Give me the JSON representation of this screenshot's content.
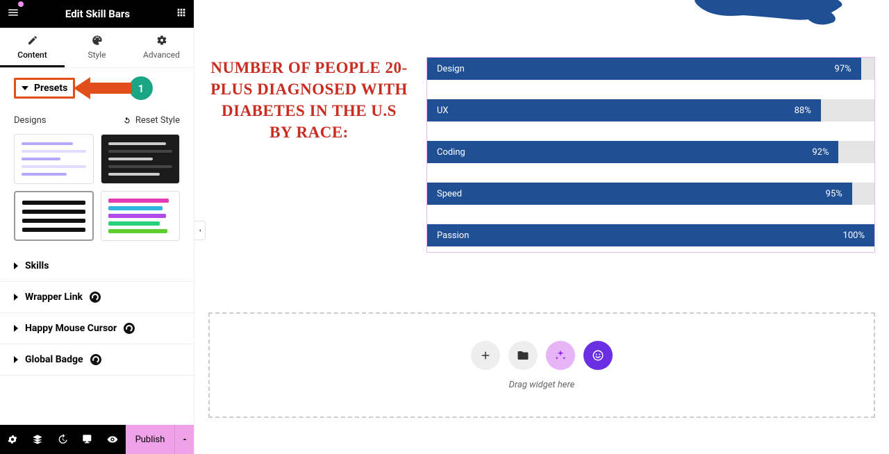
{
  "header": {
    "title": "Edit Skill Bars"
  },
  "tabs": {
    "content": "Content",
    "style": "Style",
    "advanced": "Advanced"
  },
  "accordion": {
    "presets": "Presets",
    "designs_label": "Designs",
    "reset_style": "Reset Style",
    "skills": "Skills",
    "wrapper_link": "Wrapper Link",
    "happy_mouse": "Happy Mouse Cursor",
    "global_badge": "Global Badge"
  },
  "annotation": {
    "step": "1"
  },
  "bottom": {
    "publish": "Publish"
  },
  "canvas": {
    "heading": "NUMBER OF PEOPLE 20-PLUS DIAGNOSED WITH DIABETES IN THE U.S BY RACE:",
    "drop_label": "Drag widget here"
  },
  "chart_data": {
    "type": "bar",
    "orientation": "horizontal",
    "title": "",
    "xlabel": "",
    "ylabel": "",
    "xlim": [
      0,
      100
    ],
    "unit": "%",
    "series": [
      {
        "name": "Design",
        "value": 97
      },
      {
        "name": "UX",
        "value": 88
      },
      {
        "name": "Coding",
        "value": 92
      },
      {
        "name": "Speed",
        "value": 95
      },
      {
        "name": "Passion",
        "value": 100
      }
    ]
  }
}
